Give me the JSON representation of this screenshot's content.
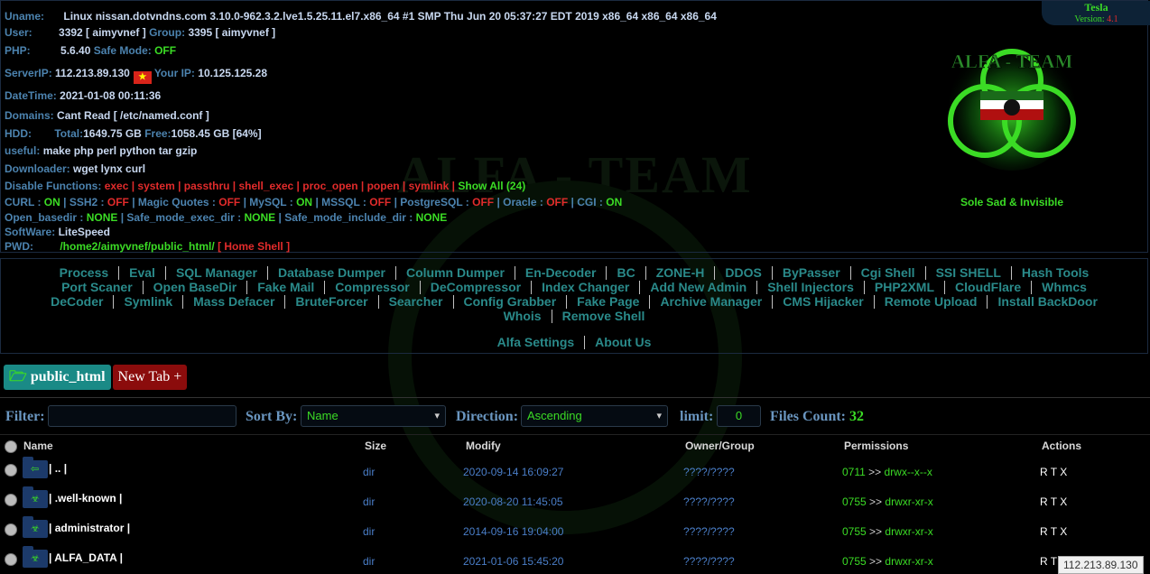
{
  "watermark": "ALFA - TEAM",
  "badge": {
    "name": "Tesla",
    "version_label": "Version:",
    "version": "4.1"
  },
  "logo_text": "ALFA - TEAM",
  "slogan": "Sole Sad & Invisible",
  "info": {
    "uname_label": "Uname:",
    "uname": "Linux nissan.dotvndns.com 3.10.0-962.3.2.lve1.5.25.11.el7.x86_64 #1 SMP Thu Jun 20 05:37:27 EDT 2019 x86_64 x86_64 x86_64",
    "user_label": "User:",
    "user": "3392 [ aimyvnef ]",
    "group_label": "Group:",
    "group": "3395 [ aimyvnef ]",
    "php_label": "PHP:",
    "php": "5.6.40",
    "safe_label": "Safe Mode:",
    "safe": "OFF",
    "serverip_label": "ServerIP:",
    "serverip": "112.213.89.130",
    "flag": "★",
    "yourip_label": "Your IP:",
    "yourip": "10.125.125.28",
    "datetime_label": "DateTime:",
    "datetime": "2021-01-08 00:11:36",
    "domains_label": "Domains:",
    "domains": "Cant Read [ /etc/named.conf ]",
    "hdd_label": "HDD:",
    "total_label": "Total:",
    "total": "1649.75 GB",
    "free_label": "Free:",
    "free": "1058.45 GB [64%]",
    "useful_label": "useful:",
    "useful": "make php perl python tar gzip",
    "downloader_label": "Downloader:",
    "downloader": "wget lynx curl",
    "disable_label": "Disable Functions:",
    "disabled": "exec | system | passthru | shell_exec | proc_open | popen | symlink |",
    "show_all": "Show All (24)",
    "curl_label": "CURL :",
    "curl": "ON",
    "ssh2_label": "| SSH2 :",
    "ssh2": "OFF",
    "magic_label": "| Magic Quotes :",
    "magic": "OFF",
    "mysql_label": "| MySQL :",
    "mysql": "ON",
    "mssql_label": "| MSSQL :",
    "mssql": "OFF",
    "pgsql_label": "| PostgreSQL :",
    "pgsql": "OFF",
    "oracle_label": "| Oracle :",
    "oracle": "OFF",
    "cgi_label": "| CGI :",
    "cgi": "ON",
    "openbasedir_label": "Open_basedir :",
    "openbasedir": "NONE",
    "safeexec_label": "| Safe_mode_exec_dir :",
    "safeexec": "NONE",
    "safeinc_label": "| Safe_mode_include_dir :",
    "safeinc": "NONE",
    "software_label": "SoftWare:",
    "software": "LiteSpeed",
    "pwd_label": "PWD:",
    "pwd": "/home2/aimyvnef/public_html/",
    "home_shell": "[ Home Shell ]"
  },
  "menu": {
    "line1": [
      "Process",
      "Eval",
      "SQL Manager",
      "Database Dumper",
      "Column Dumper",
      "En-Decoder",
      "BC",
      "ZONE-H",
      "DDOS",
      "ByPasser",
      "Cgi Shell",
      "SSI SHELL",
      "Hash Tools"
    ],
    "line2": [
      "Port Scaner",
      "Open BaseDir",
      "Fake Mail",
      "Compressor",
      "DeCompressor",
      "Index Changer",
      "Add New Admin",
      "Shell Injectors",
      "PHP2XML",
      "CloudFlare",
      "Whmcs"
    ],
    "line3": [
      "DeCoder",
      "Symlink",
      "Mass Defacer",
      "BruteForcer",
      "Searcher",
      "Config Grabber",
      "Fake Page",
      "Archive Manager",
      "CMS Hijacker",
      "Remote Upload",
      "Install BackDoor"
    ],
    "line4": [
      "Whois",
      "Remove Shell"
    ],
    "line5": [
      "Alfa Settings",
      "About Us"
    ]
  },
  "tabs": {
    "current": "public_html",
    "new_tab": "New Tab +"
  },
  "filterbar": {
    "filter_label": "Filter:",
    "filter_value": "",
    "sort_label": "Sort By:",
    "sort_value": "Name",
    "direction_label": "Direction:",
    "direction_value": "Ascending",
    "limit_label": "limit:",
    "limit_value": "0",
    "count_label": "Files Count:",
    "count": "32"
  },
  "table": {
    "headers": {
      "name": "Name",
      "size": "Size",
      "modify": "Modify",
      "owner": "Owner/Group",
      "permissions": "Permissions",
      "actions": "Actions"
    },
    "rows": [
      {
        "name": "| .. |",
        "icon": "up-arrow-icon",
        "size": "dir",
        "modify": "2020-09-14 16:09:27",
        "owner": "????/????",
        "perm_num": "0711",
        "perm_str": "drwx--x--x",
        "actions": "R T X"
      },
      {
        "name": "| .well-known |",
        "icon": "biohazard-icon",
        "size": "dir",
        "modify": "2020-08-20 11:45:05",
        "owner": "????/????",
        "perm_num": "0755",
        "perm_str": "drwxr-xr-x",
        "actions": "R T X"
      },
      {
        "name": "| administrator |",
        "icon": "biohazard-icon",
        "size": "dir",
        "modify": "2014-09-16 19:04:00",
        "owner": "????/????",
        "perm_num": "0755",
        "perm_str": "drwxr-xr-x",
        "actions": "R T X"
      },
      {
        "name": "| ALFA_DATA |",
        "icon": "biohazard-icon",
        "size": "dir",
        "modify": "2021-01-06 15:45:20",
        "owner": "????/????",
        "perm_num": "0755",
        "perm_str": "drwxr-xr-x",
        "actions": "R T"
      }
    ]
  },
  "tooltip": "112.213.89.130"
}
